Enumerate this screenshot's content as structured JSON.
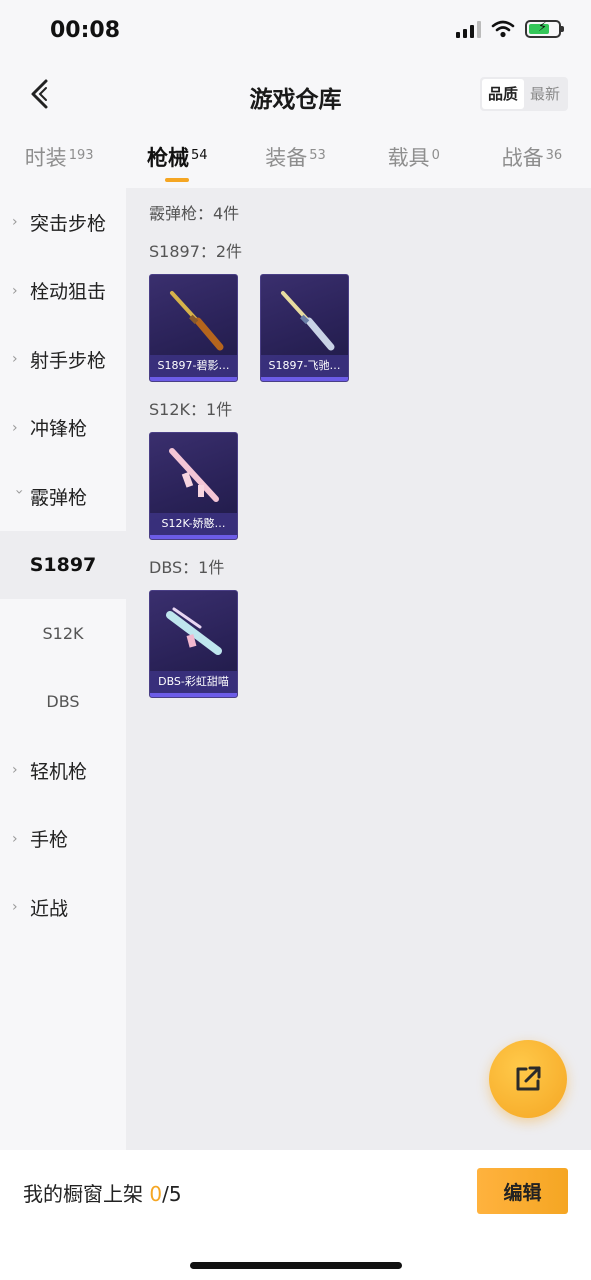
{
  "status_bar": {
    "time": "00:08"
  },
  "nav": {
    "title": "游戏仓库",
    "sort_options": [
      "品质",
      "最新"
    ],
    "active_sort": "品质"
  },
  "tabs": [
    {
      "label": "时装",
      "count": "193"
    },
    {
      "label": "枪械",
      "count": "54"
    },
    {
      "label": "装备",
      "count": "53"
    },
    {
      "label": "载具",
      "count": "0"
    },
    {
      "label": "战备",
      "count": "36"
    }
  ],
  "sidebar": {
    "items": [
      {
        "label": "突击步枪",
        "expanded": false
      },
      {
        "label": "栓动狙击",
        "expanded": false
      },
      {
        "label": "射手步枪",
        "expanded": false
      },
      {
        "label": "冲锋枪",
        "expanded": false
      },
      {
        "label": "霰弹枪",
        "expanded": true
      },
      {
        "label": "轻机枪",
        "expanded": false
      },
      {
        "label": "手枪",
        "expanded": false
      },
      {
        "label": "近战",
        "expanded": false
      }
    ],
    "sub_items": [
      "S1897",
      "S12K",
      "DBS"
    ],
    "active_sub": "S1897"
  },
  "content": {
    "category_header": "霰弹枪：4件",
    "groups": [
      {
        "header": "S1897：2件",
        "cards": [
          {
            "label": "S1897-碧影…"
          },
          {
            "label": "S1897-飞驰…"
          }
        ]
      },
      {
        "header": "S12K：1件",
        "cards": [
          {
            "label": "S12K-娇憨…"
          }
        ]
      },
      {
        "header": "DBS：1件",
        "cards": [
          {
            "label": "DBS-彩虹甜喵"
          }
        ]
      }
    ]
  },
  "bottom": {
    "showcase_label": "我的橱窗上架 ",
    "showcase_count": "0",
    "showcase_total": "/5",
    "edit_label": "编辑"
  },
  "colors": {
    "accent": "#f5a623",
    "card_bg": "#2a2258",
    "card_label_bg": "#3c3282"
  }
}
